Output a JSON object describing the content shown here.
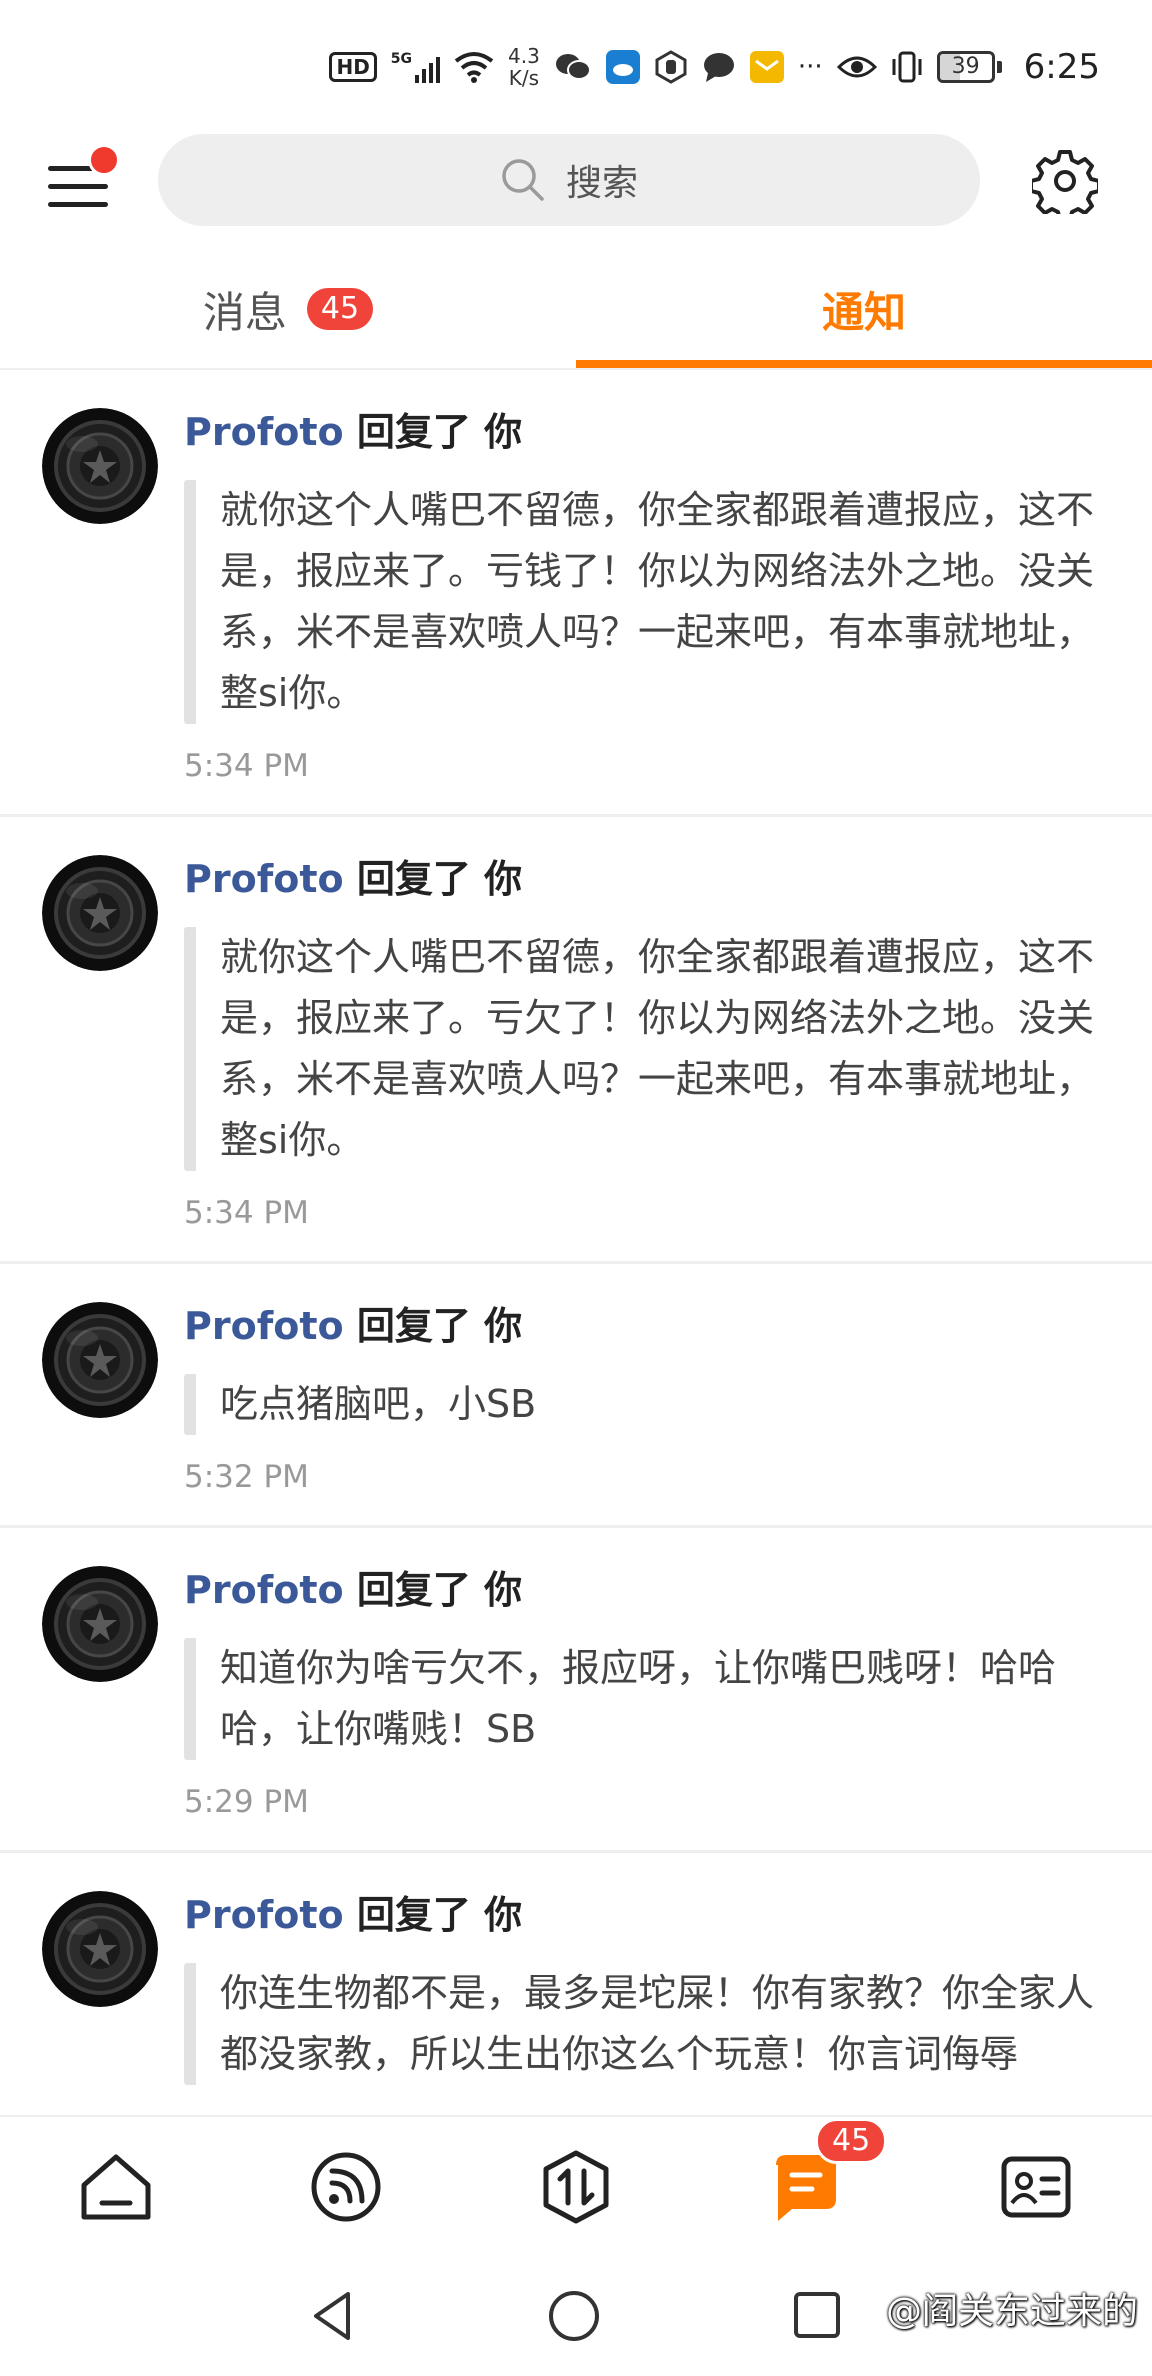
{
  "status_bar": {
    "hd": "HD",
    "signal": "5G",
    "speed_value": "4.3",
    "speed_unit": "K/s",
    "battery": "39",
    "battery_level": 0.39,
    "time": "6:25"
  },
  "header": {
    "search_placeholder": "搜索"
  },
  "tabs": [
    {
      "label": "消息",
      "badge": "45",
      "active": false
    },
    {
      "label": "通知",
      "active": true
    }
  ],
  "notifications": [
    {
      "user": "Profoto",
      "action": "回复了 你",
      "text": "就你这个人嘴巴不留德，你全家都跟着遭报应，这不是，报应来了。亏钱了！你以为网络法外之地。没关系，米不是喜欢喷人吗？一起来吧，有本事就地址，整si你。",
      "time": "5:34 PM"
    },
    {
      "user": "Profoto",
      "action": "回复了 你",
      "text": "就你这个人嘴巴不留德，你全家都跟着遭报应，这不是，报应来了。亏欠了！你以为网络法外之地。没关系，米不是喜欢喷人吗？一起来吧，有本事就地址，整si你。",
      "time": "5:34 PM"
    },
    {
      "user": "Profoto",
      "action": "回复了 你",
      "text": "吃点猪脑吧，小SB",
      "time": "5:32 PM"
    },
    {
      "user": "Profoto",
      "action": "回复了 你",
      "text": "知道你为啥亏欠不，报应呀，让你嘴巴贱呀！哈哈哈，让你嘴贱！SB",
      "time": "5:29 PM"
    },
    {
      "user": "Profoto",
      "action": "回复了 你",
      "text": "你连生物都不是，最多是坨屎！你有家教？你全家人都没家教，所以生出你这么个玩意！你言词侮辱",
      "time": ""
    }
  ],
  "bottom_nav": {
    "items": [
      "home-icon",
      "feed-icon",
      "swap-icon",
      "messages-icon",
      "profile-card-icon"
    ],
    "messages_badge": "45"
  },
  "watermark": "@阎关东过来的",
  "colors": {
    "accent": "#ff7a00",
    "badge": "#f0443a",
    "username": "#3b5998"
  }
}
